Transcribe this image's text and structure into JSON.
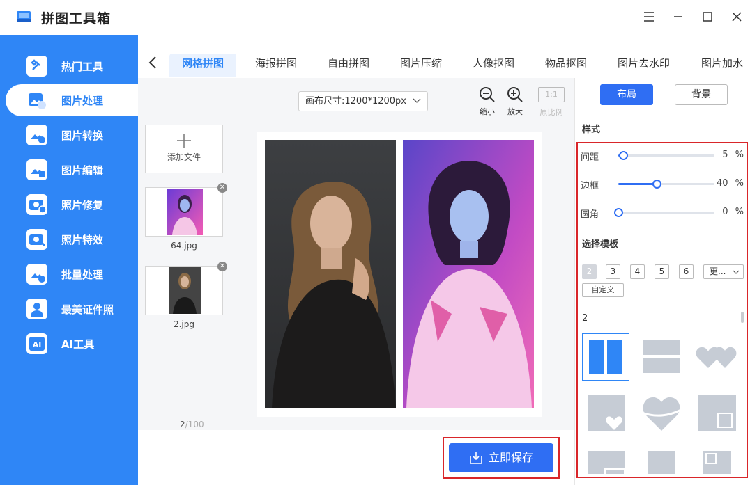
{
  "app": {
    "title": "拼图工具箱"
  },
  "sidebar": {
    "items": [
      {
        "label": "热门工具",
        "icon": "tools-icon"
      },
      {
        "label": "图片处理",
        "icon": "image-process-icon"
      },
      {
        "label": "图片转换",
        "icon": "image-convert-icon"
      },
      {
        "label": "图片编辑",
        "icon": "image-edit-icon"
      },
      {
        "label": "照片修复",
        "icon": "photo-repair-icon"
      },
      {
        "label": "照片特效",
        "icon": "photo-effects-icon"
      },
      {
        "label": "批量处理",
        "icon": "batch-icon"
      },
      {
        "label": "最美证件照",
        "icon": "id-photo-icon"
      },
      {
        "label": "AI工具",
        "icon": "ai-icon"
      }
    ],
    "active_index": 1
  },
  "tabs": [
    "网格拼图",
    "海报拼图",
    "自由拼图",
    "图片压缩",
    "人像抠图",
    "物品抠图",
    "图片去水印",
    "图片加水"
  ],
  "toolbar": {
    "canvas_size": "画布尺寸:1200*1200px",
    "zoom_out": "缩小",
    "zoom_in": "放大",
    "ratio_box": "1:1",
    "original_ratio": "原比例"
  },
  "files": {
    "add_label": "添加文件",
    "items": [
      {
        "name": "64.jpg"
      },
      {
        "name": "2.jpg"
      }
    ],
    "page_current": "2",
    "page_total": "/100"
  },
  "save": {
    "label": "立即保存"
  },
  "panel": {
    "tab_layout": "布局",
    "tab_background": "背景",
    "style_title": "样式",
    "sliders": [
      {
        "name": "间距",
        "value": 5,
        "unit": "%"
      },
      {
        "name": "边框",
        "value": 40,
        "unit": "%"
      },
      {
        "name": "圆角",
        "value": 0,
        "unit": "%"
      }
    ],
    "template_title": "选择模板",
    "counts": [
      "2",
      "3",
      "4",
      "5",
      "6"
    ],
    "selected_count": "2",
    "more": "更...",
    "custom": "自定义",
    "group_label": "2"
  },
  "colors": {
    "accent": "#2f86f6",
    "button": "#2f6ef3",
    "highlight": "#d9262a"
  }
}
